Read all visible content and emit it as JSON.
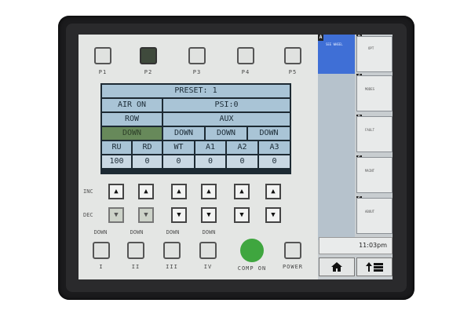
{
  "presets": [
    {
      "label": "P1",
      "active": false
    },
    {
      "label": "P2",
      "active": true
    },
    {
      "label": "P3",
      "active": false
    },
    {
      "label": "P4",
      "active": false
    },
    {
      "label": "P5",
      "active": false
    }
  ],
  "panel": {
    "preset": "PRESET: 1",
    "air": "AIR ON",
    "psi": "PSI:0",
    "row": "ROW",
    "aux": "AUX",
    "statuses": [
      "DOWN",
      "DOWN",
      "DOWN",
      "DOWN"
    ],
    "headers": [
      "RU",
      "RD",
      "WT",
      "A1",
      "A2",
      "A3"
    ],
    "values": [
      "100",
      "0",
      "0",
      "0",
      "0",
      "0"
    ]
  },
  "controls": {
    "inc_label": "INC",
    "dec_label": "DEC",
    "up_glyph": "▲",
    "down_glyph": "▼",
    "down_labels": [
      "DOWN",
      "DOWN",
      "DOWN",
      "DOWN"
    ]
  },
  "bottom": {
    "labels": [
      "I",
      "II",
      "III",
      "IV"
    ],
    "comp_on": "COMP ON",
    "power": "POWER",
    "comp_color": "#3fa63f"
  },
  "side": {
    "letters": [
      "A",
      "B",
      "C",
      "D",
      "E",
      "F",
      "G"
    ],
    "softkeys": [
      "OPT",
      "MODES",
      "FAULT",
      "MAINT",
      "ABOUT"
    ],
    "tab_a": "SEE WHEEL",
    "clock": "11:03pm",
    "home_icon": "home-icon",
    "menu_icon": "menu-icon",
    "accent": "#3f6fd6"
  }
}
